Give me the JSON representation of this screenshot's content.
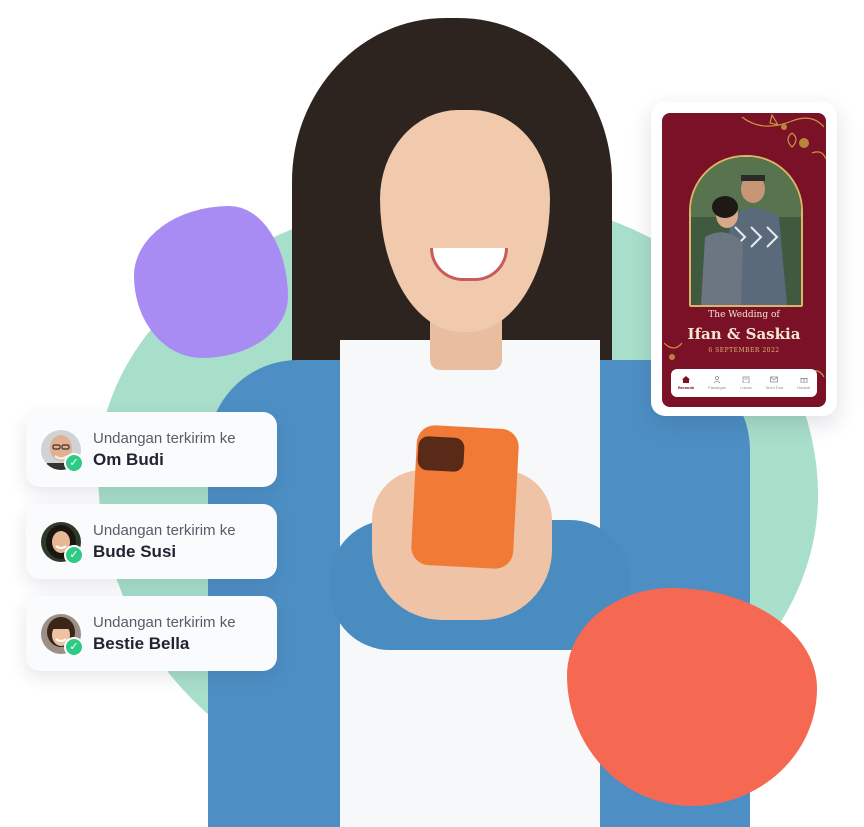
{
  "notifications": [
    {
      "prefix": "Undangan terkirim ke",
      "name": "Om Budi",
      "avatar_icon": "avatar-bald-man-glasses",
      "check_icon": "check-icon"
    },
    {
      "prefix": "Undangan terkirim ke",
      "name": "Bude Susi",
      "avatar_icon": "avatar-woman-dark-hair",
      "check_icon": "check-icon"
    },
    {
      "prefix": "Undangan terkirim ke",
      "name": "Bestie Bella",
      "avatar_icon": "avatar-young-woman",
      "check_icon": "check-icon"
    }
  ],
  "invitation": {
    "subtitle": "The Wedding of",
    "names": "Ifan & Saskia",
    "date": "6 SEPTEMBER 2022",
    "nav": [
      {
        "label": "Beranda",
        "icon": "home-icon",
        "active": true
      },
      {
        "label": "Pasangan",
        "icon": "couple-icon",
        "active": false
      },
      {
        "label": "Lokasi",
        "icon": "location-icon",
        "active": false
      },
      {
        "label": "Kirim Doa",
        "icon": "mail-icon",
        "active": false
      },
      {
        "label": "Hadiah",
        "icon": "gift-icon",
        "active": false
      }
    ]
  },
  "colors": {
    "green_blob": "#a8dfca",
    "purple_blob": "#a98bf4",
    "coral_blob": "#f56852",
    "invitation_bg": "#7a1126",
    "check": "#2ecb86"
  }
}
